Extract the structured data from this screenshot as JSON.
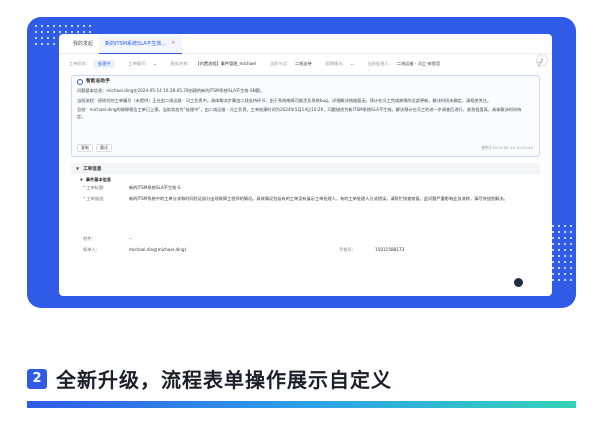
{
  "window": {
    "tabs": [
      {
        "label": "我的发起"
      },
      {
        "label": "新的ITSM系统SLA不生效...",
        "active": true
      }
    ],
    "close_glyph": "×",
    "filters": [
      {
        "label": "工单状态：",
        "value": "处理中",
        "is_tag": true
      },
      {
        "label": "工单编号：",
        "value": "--"
      },
      {
        "label": "服务名称：",
        "value": "【内置流程】事件管理_michael"
      },
      {
        "label": "当前节点：",
        "value": "二线支持"
      },
      {
        "label": "超期情况：",
        "value": "--"
      },
      {
        "label": "当前处理人：",
        "value": "二线运维 - 冯工-宋思哲"
      }
    ]
  },
  "ai_assistant": {
    "title": "智能总助手",
    "paragraphs": [
      "问题基本信息：michael.ding在2024-05-14 10:28:05.78创建的新的ITSM系统SLA不生效-SN题。",
      "当前流程：经研究的工单编号（未提供）正在由二线运维 - 冯工负责中。具体解决步骤由二线支持环节，由于系统故障可能涉及系统bug，详细解决措施暂无。预计在冯工完成故障的全部更新，解决时间未确定，请相关关注。",
      "总结：michael.ding的故障报告工单已上报，当前状态为“处理中”，由二线运维 - 冯工负责。工单创建时间为2024年5月14日10:26，问题描述为新ITSM系统SLA不生效。解决预计在冯工的进一步调查后进行，紧急程度高，具体解决时间待定。"
    ],
    "copy_label": "复制",
    "retry_label": "重试",
    "updated": "更新于2024-05-14 10:35:40"
  },
  "ticket_info": {
    "section_title": "工单信息",
    "sub_title": "事件基本信息",
    "fields": [
      {
        "key": "* 工单标题:",
        "value": "新的ITSM系统SLA不生效-S"
      },
      {
        "key": "* 工单描述:",
        "value": "新的ITSM系统中的工单分派和时间验证部分出现故障工程师的情况。具体情况包括有的工单没有展示工单处理人，有的工单处理人分派错误，请帮忙排查修复。此问题严重影响业务流转，请尽快加急解决。"
      }
    ],
    "attachment": {
      "key": "附件：",
      "value": "--"
    },
    "reporter": {
      "key": "报单人：",
      "value": "michael.ding(michael.ding)"
    },
    "phone": {
      "key": "手机号：",
      "value": "15011588173"
    }
  },
  "heading": {
    "number": "2",
    "text": "全新升级，流程表单操作展示自定义"
  },
  "icons": [
    "close-icon",
    "ai-assistant-icon",
    "filter-settings-icon",
    "side-toggle-icon",
    "chat-bubble-icon"
  ],
  "colors": {
    "brand_blue": "#2f5be7",
    "gradient_end": "#34d2b7",
    "link_blue": "#2b5ce8"
  }
}
